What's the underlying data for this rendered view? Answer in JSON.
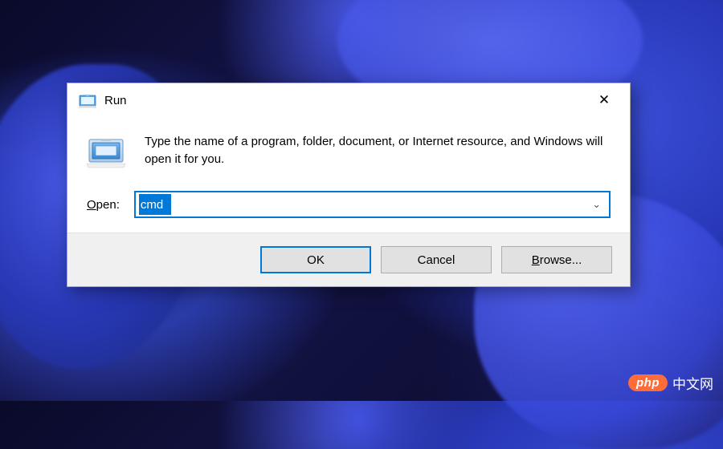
{
  "dialog": {
    "title": "Run",
    "description": "Type the name of a program, folder, document, or Internet resource, and Windows will open it for you.",
    "open_label_pre": "O",
    "open_label_post": "pen:",
    "input_value": "cmd",
    "buttons": {
      "ok": "OK",
      "cancel": "Cancel",
      "browse_pre": "B",
      "browse_post": "rowse..."
    }
  },
  "watermark": {
    "badge": "php",
    "text": "中文网"
  }
}
